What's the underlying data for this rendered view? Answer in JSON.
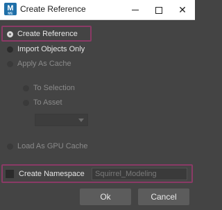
{
  "window": {
    "title": "Create Reference",
    "app_icon_letter": "M",
    "app_icon_sub": "ME"
  },
  "options": {
    "create_reference": "Create Reference",
    "import_objects_only": "Import Objects Only",
    "apply_as_cache": "Apply As Cache",
    "to_selection": "To Selection",
    "to_asset": "To Asset",
    "load_as_gpu_cache": "Load As GPU Cache"
  },
  "namespace": {
    "label": "Create Namespace",
    "checked": false,
    "value": "Squirrel_Modeling"
  },
  "buttons": {
    "ok": "Ok",
    "cancel": "Cancel"
  },
  "colors": {
    "highlight": "#8b3a66",
    "background": "#444444"
  }
}
